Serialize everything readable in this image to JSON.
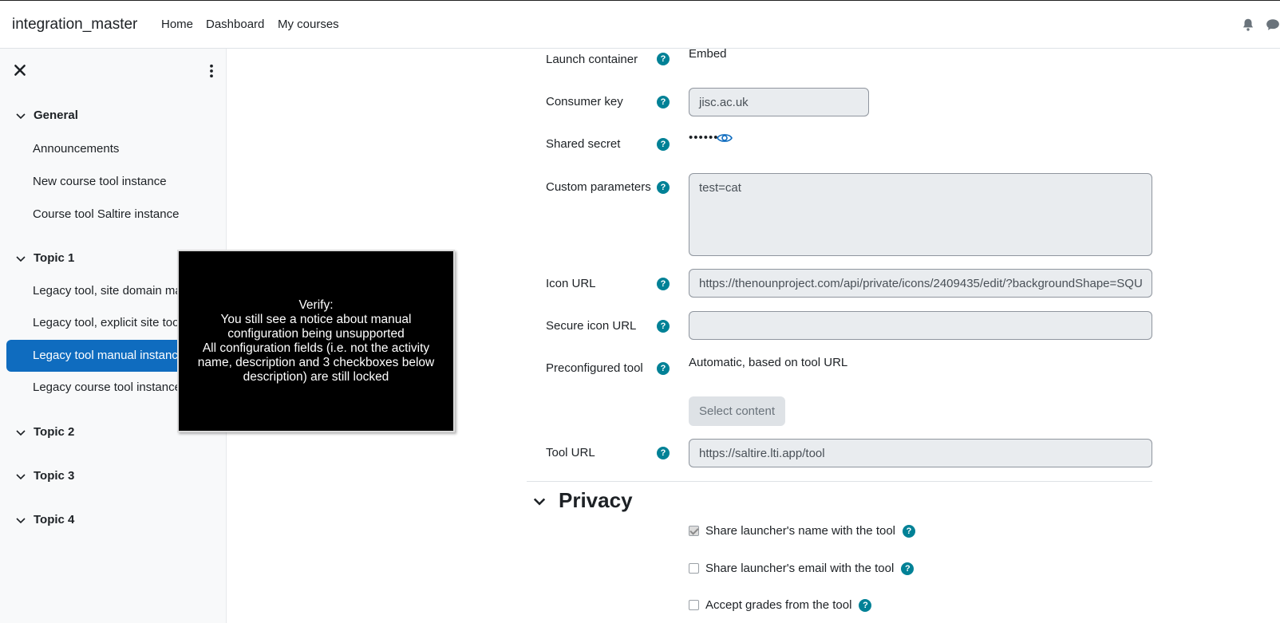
{
  "navbar": {
    "brand": "integration_master",
    "links": [
      "Home",
      "Dashboard",
      "My courses"
    ],
    "icons": [
      "bell-icon",
      "chat-icon"
    ]
  },
  "drawer": {
    "sections": [
      {
        "title": "General",
        "items": [
          "Announcements",
          "New course tool instance",
          "Course tool Saltire instance"
        ]
      },
      {
        "title": "Topic 1",
        "items": [
          "Legacy tool, site domain ma",
          "Legacy tool, explicit site too",
          "Legacy tool manual instanc",
          "Legacy course tool instance"
        ]
      },
      {
        "title": "Topic 2",
        "items": []
      },
      {
        "title": "Topic 3",
        "items": []
      },
      {
        "title": "Topic 4",
        "items": []
      }
    ],
    "active_item": "Legacy tool manual instanc"
  },
  "form": {
    "launch_container": {
      "label": "Launch container",
      "value": "Embed"
    },
    "consumer_key": {
      "label": "Consumer key",
      "value": "jisc.ac.uk"
    },
    "shared_secret": {
      "label": "Shared secret",
      "value": "••••••"
    },
    "custom_parameters": {
      "label": "Custom parameters",
      "value": "test=cat"
    },
    "icon_url": {
      "label": "Icon URL",
      "value": "https://thenounproject.com/api/private/icons/2409435/edit/?backgroundShape=SQU"
    },
    "secure_icon_url": {
      "label": "Secure icon URL",
      "value": ""
    },
    "preconfigured_tool": {
      "label": "Preconfigured tool",
      "value": "Automatic, based on tool URL"
    },
    "select_content_label": "Select content",
    "tool_url": {
      "label": "Tool URL",
      "value": "https://saltire.lti.app/tool"
    },
    "help_symbol": "?"
  },
  "privacy": {
    "title": "Privacy",
    "options": [
      {
        "label": "Share launcher's name with the tool",
        "checked": true
      },
      {
        "label": "Share launcher's email with the tool",
        "checked": false
      },
      {
        "label": "Accept grades from the tool",
        "checked": false
      }
    ]
  },
  "overlay": {
    "lines": [
      "Verify:",
      "You still see a notice about manual",
      "configuration being unsupported",
      "All configuration fields (i.e. not the activity",
      "name, description and 3 checkboxes below",
      "description) are still locked"
    ]
  },
  "colors": {
    "accent": "#0f6cbf",
    "help_icon": "#008196",
    "overlay_bg": "#000000"
  }
}
